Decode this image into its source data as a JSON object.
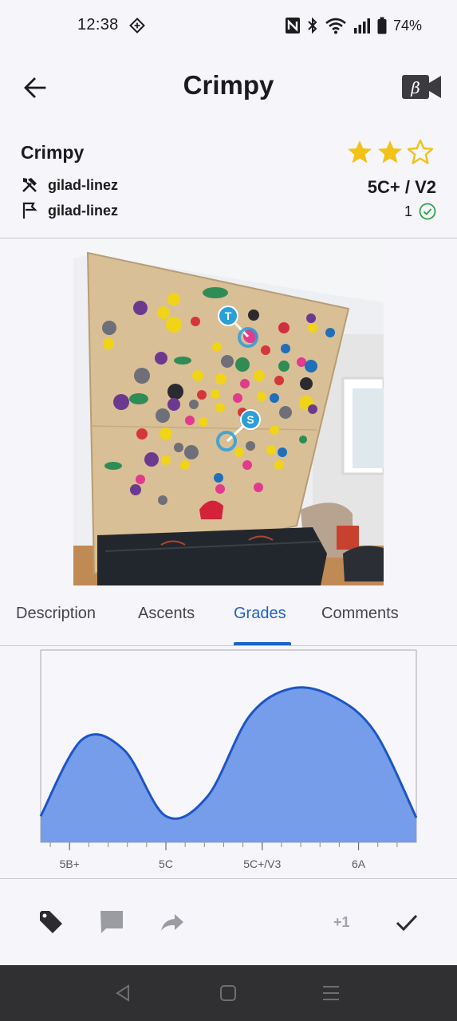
{
  "status_bar": {
    "time": "12:38",
    "battery": "74%",
    "icons": [
      "nfc-icon",
      "bluetooth-icon",
      "wifi-icon",
      "signal-icon",
      "battery-icon"
    ]
  },
  "app_bar": {
    "title": "Crimpy",
    "back_icon": "arrow-left-icon",
    "beta_label": "β"
  },
  "problem": {
    "name": "Crimpy",
    "setter": "gilad-linez",
    "first_ascent": "gilad-linez",
    "grade": "5C+ / V2",
    "ascents": "1",
    "rating": 2,
    "rating_max": 3,
    "colors": {
      "star": "#f2c216",
      "check": "#2fa54a"
    }
  },
  "photo": {
    "hold_markers": [
      "T",
      "S"
    ],
    "marker_color": "#2a9fd8"
  },
  "tabs": [
    {
      "label": "Description",
      "active": false
    },
    {
      "label": "Ascents",
      "active": false
    },
    {
      "label": "Grades",
      "active": true
    },
    {
      "label": "Comments",
      "active": false
    }
  ],
  "chart_data": {
    "type": "area",
    "title": "",
    "xlabel": "",
    "ylabel": "",
    "x_tick_labels": [
      "5B+",
      "5C",
      "5C+/V3",
      "6A"
    ],
    "series": [
      {
        "x": [
          0,
          0.5,
          1,
          1.5,
          2,
          2.5,
          3,
          3.5,
          4,
          4.5
        ],
        "values": [
          0.17,
          0.67,
          0.6,
          0.17,
          0.3,
          0.82,
          1.0,
          0.95,
          0.72,
          0.16
        ]
      }
    ],
    "xlim": [
      -0.3,
      3.6
    ],
    "ylim": [
      0,
      1.25
    ],
    "colors": {
      "fill": "#6f98e8",
      "line": "#1e55c6"
    }
  },
  "actions": {
    "tag_icon": "tag-icon",
    "comment_icon": "comment-icon",
    "share_icon": "share-icon",
    "plus_one": "+1",
    "tick_icon": "check-icon"
  },
  "nav": [
    "back-nav-icon",
    "home-nav-icon",
    "recents-nav-icon"
  ]
}
